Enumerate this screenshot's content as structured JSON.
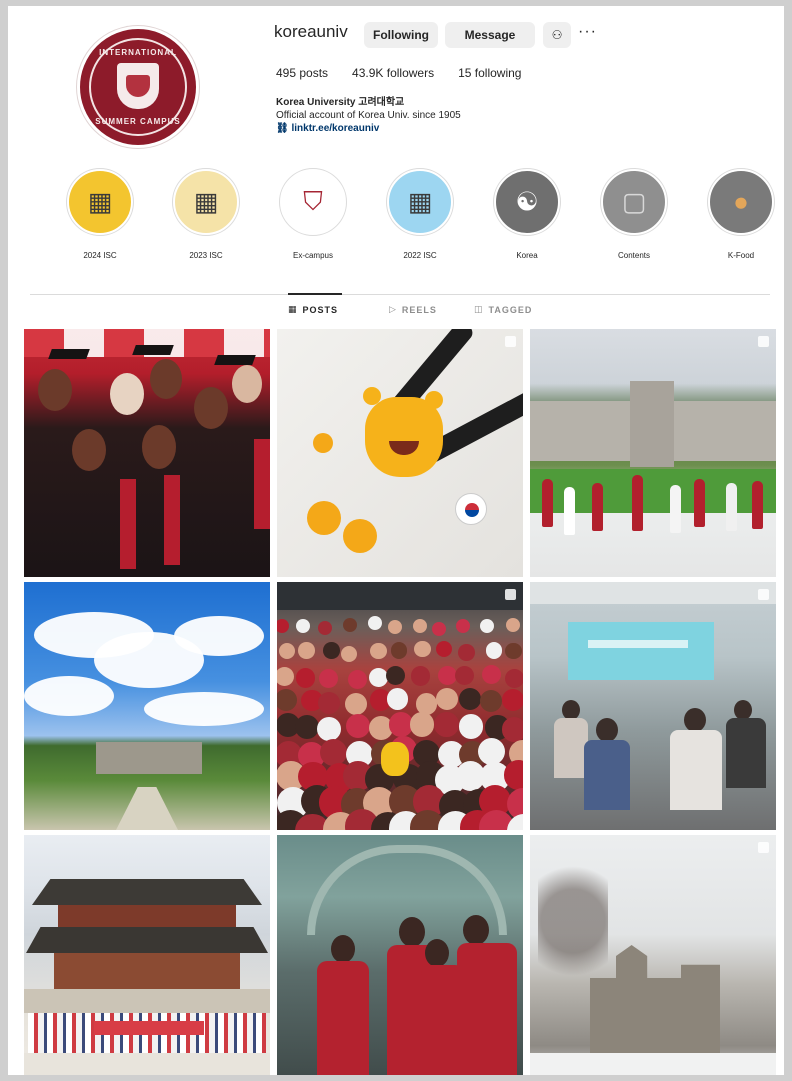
{
  "profile": {
    "username": "koreauniv",
    "follow_label": "Following",
    "message_label": "Message",
    "posts_count": "495 posts",
    "followers_count": "43.9K followers",
    "following_count": "15 following",
    "display_name": "Korea University 고려대학교",
    "bio_line": "Official account of Korea Univ. since 1905",
    "bio_link": "linktr.ee/koreauniv",
    "avatar_text_top": "INTERNATIONAL",
    "avatar_text_bottom": "SUMMER CAMPUS"
  },
  "highlights": [
    {
      "label": "2024 ISC",
      "color": "#f3c52f",
      "inner": "#3a3a3a",
      "glyph": "▦"
    },
    {
      "label": "2023 ISC",
      "color": "#f5e3a8",
      "inner": "#3a3a3a",
      "glyph": "▦"
    },
    {
      "label": "Ex-campus",
      "color": "#ffffff",
      "inner": "#a52533",
      "glyph": "⛉"
    },
    {
      "label": "2022 ISC",
      "color": "#9dd6f1",
      "inner": "#3a3a3a",
      "glyph": "▦"
    },
    {
      "label": "Korea",
      "color": "#6f6f6f",
      "inner": "#ffffff",
      "glyph": "☯"
    },
    {
      "label": "Contents",
      "color": "#8f8f8f",
      "inner": "#d8d8d8",
      "glyph": "▢"
    },
    {
      "label": "K-Food",
      "color": "#7a7a7a",
      "inner": "#e3a65a",
      "glyph": "●"
    }
  ],
  "tabs": [
    {
      "label": "POSTS",
      "icon": "grid-icon",
      "active": true
    },
    {
      "label": "REELS",
      "icon": "reels-icon",
      "active": false
    },
    {
      "label": "TAGGED",
      "icon": "tagged-icon",
      "active": false
    }
  ],
  "colors": {
    "brand": "#8d1b2a",
    "accent_red": "#b51e2e"
  }
}
